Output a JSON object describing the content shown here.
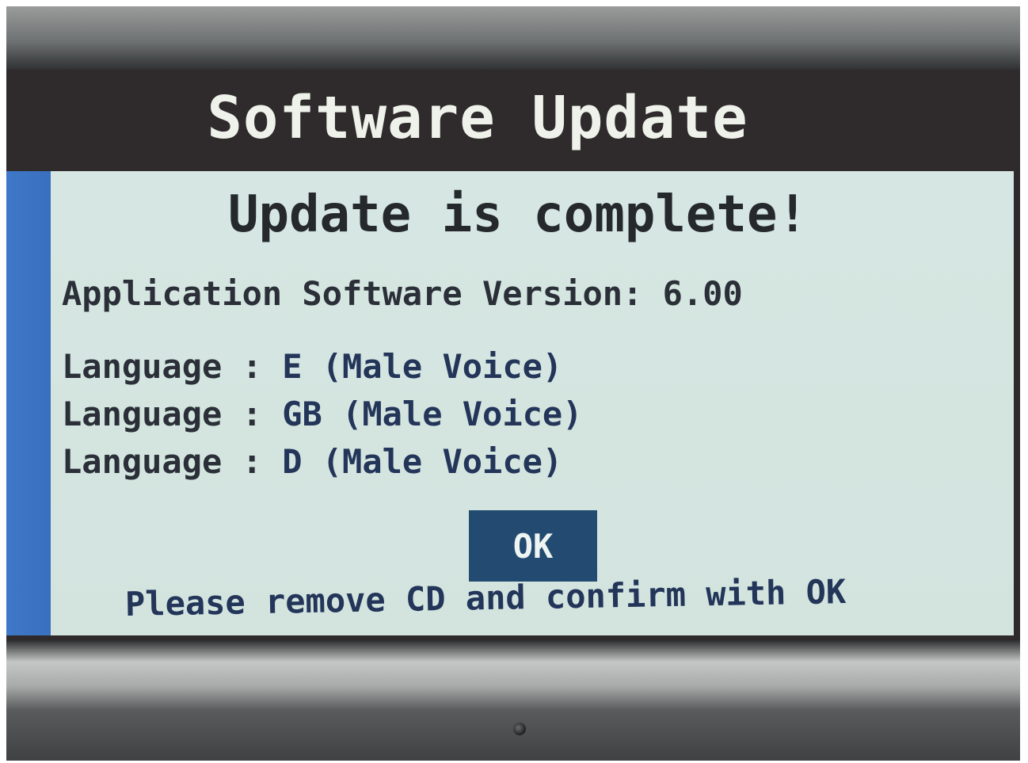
{
  "header": {
    "title": "Software Update"
  },
  "dialog": {
    "headline": "Update is complete!",
    "version_line": "Application Software Version: 6.00",
    "languages": [
      {
        "label": "Language",
        "separator": ":",
        "value": "E (Male Voice)"
      },
      {
        "label": "Language",
        "separator": ":",
        "value": "GB (Male Voice)"
      },
      {
        "label": "Language",
        "separator": ":",
        "value": "D (Male Voice)"
      }
    ],
    "ok_label": "OK",
    "hint": "Please remove CD and confirm with OK"
  },
  "colors": {
    "title_bar": "#2f2a2c",
    "content_background": "#d6e6e2",
    "accent_strip": "#3f78c8",
    "ok_button": "#234b71",
    "text_dark": "#2b3038",
    "text_blue": "#233559"
  }
}
